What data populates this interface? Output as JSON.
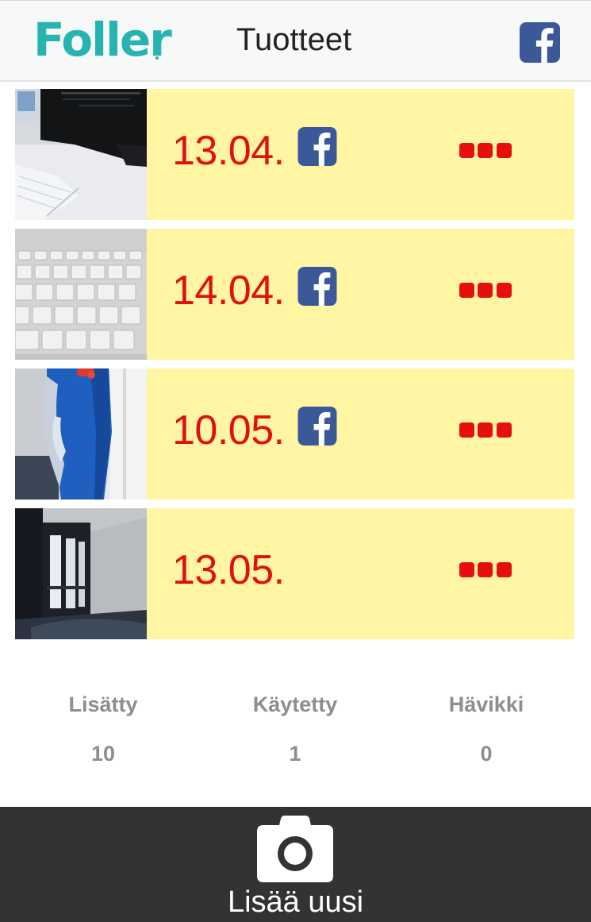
{
  "header": {
    "logo_text": "Foller",
    "title": "Tuotteet",
    "share_icon": "facebook-icon"
  },
  "products": [
    {
      "date": "13.04.",
      "shared_on_facebook": true,
      "image": "desk-with-monitor-and-notepad",
      "menu_icon": "more-dots-icon"
    },
    {
      "date": "14.04.",
      "shared_on_facebook": true,
      "image": "keyboard",
      "menu_icon": "more-dots-icon"
    },
    {
      "date": "10.05.",
      "shared_on_facebook": true,
      "image": "blue-towel",
      "menu_icon": "more-dots-icon"
    },
    {
      "date": "13.05.",
      "shared_on_facebook": false,
      "image": "room-with-window",
      "menu_icon": "more-dots-icon"
    }
  ],
  "stats": [
    {
      "label": "Lisätty",
      "value": "10"
    },
    {
      "label": "Käytetty",
      "value": "1"
    },
    {
      "label": "Hävikki",
      "value": "0"
    }
  ],
  "add_button": {
    "label": "Lisää uusi",
    "icon": "camera-icon"
  },
  "colors": {
    "brand": "#27b3b0",
    "row_background": "#fff5a3",
    "date_text": "#e0100f",
    "menu_dots": "#e50f0f",
    "facebook": "#3b5998",
    "bottom_bar": "#333333",
    "stat_text": "#8e8e8e"
  }
}
